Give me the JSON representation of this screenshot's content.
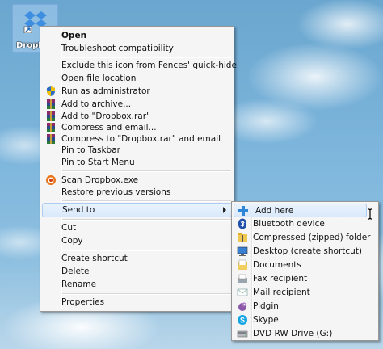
{
  "desktop": {
    "icon_label": "Dropbox",
    "icon_name": "dropbox-shortcut-icon"
  },
  "context_menu": {
    "items": [
      {
        "label": "Open",
        "bold": true
      },
      {
        "label": "Troubleshoot compatibility"
      },
      {
        "label": "Exclude this icon from Fences' quick-hide"
      },
      {
        "label": "Open file location"
      },
      {
        "label": "Run as administrator",
        "icon": "uac-shield-icon"
      },
      {
        "label": "Add to archive...",
        "icon": "winrar-icon"
      },
      {
        "label": "Add to \"Dropbox.rar\"",
        "icon": "winrar-icon"
      },
      {
        "label": "Compress and email...",
        "icon": "winrar-icon"
      },
      {
        "label": "Compress to \"Dropbox.rar\" and email",
        "icon": "winrar-icon"
      },
      {
        "label": "Pin to Taskbar"
      },
      {
        "label": "Pin to Start Menu"
      },
      {
        "label": "Scan Dropbox.exe",
        "icon": "antivirus-icon"
      },
      {
        "label": "Restore previous versions"
      },
      {
        "label": "Send to",
        "submenu": true,
        "highlighted": true
      },
      {
        "label": "Cut"
      },
      {
        "label": "Copy"
      },
      {
        "label": "Create shortcut"
      },
      {
        "label": "Delete"
      },
      {
        "label": "Rename"
      },
      {
        "label": "Properties"
      }
    ]
  },
  "send_to_menu": {
    "items": [
      {
        "label": "Add here",
        "icon": "plus-icon",
        "highlighted": true
      },
      {
        "label": "Bluetooth device",
        "icon": "bluetooth-icon"
      },
      {
        "label": "Compressed (zipped) folder",
        "icon": "zip-folder-icon"
      },
      {
        "label": "Desktop (create shortcut)",
        "icon": "desktop-icon"
      },
      {
        "label": "Documents",
        "icon": "documents-icon"
      },
      {
        "label": "Fax recipient",
        "icon": "fax-icon"
      },
      {
        "label": "Mail recipient",
        "icon": "mail-icon"
      },
      {
        "label": "Pidgin",
        "icon": "pidgin-icon"
      },
      {
        "label": "Skype",
        "icon": "skype-icon"
      },
      {
        "label": "DVD RW Drive (G:)",
        "icon": "dvd-drive-icon"
      }
    ]
  },
  "colors": {
    "menu_bg": "#f5f5f5",
    "highlight": "#d9e9fb",
    "highlight_border": "#aecbf0"
  }
}
